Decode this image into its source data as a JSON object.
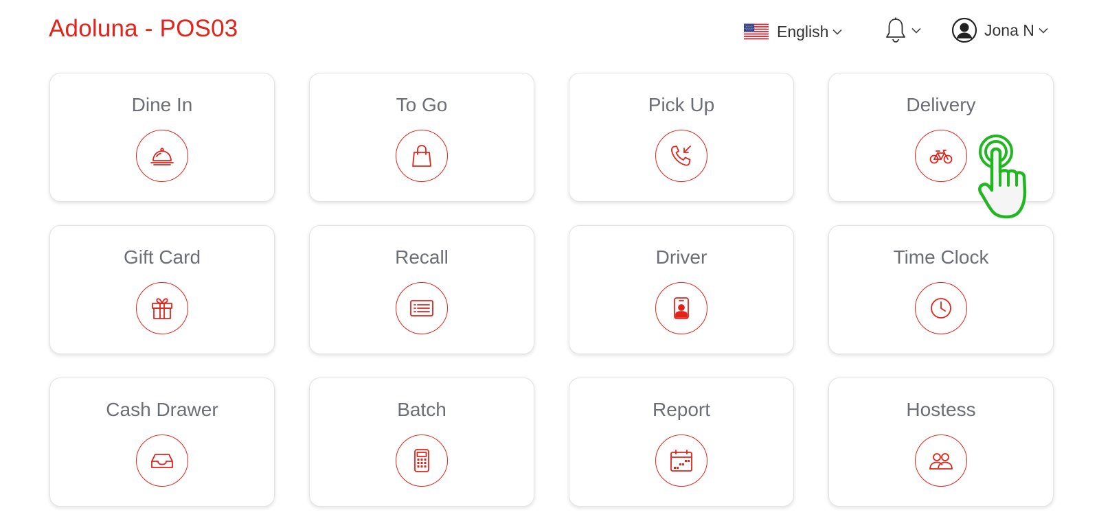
{
  "header": {
    "title": "Adoluna - POS03",
    "language": {
      "label": "English",
      "flag_icon": "us-flag-icon"
    },
    "notifications": {
      "icon": "bell-icon"
    },
    "user": {
      "name": "Jona N",
      "icon": "user-avatar-icon"
    }
  },
  "tiles": [
    {
      "label": "Dine In",
      "icon": "serving-cloche-icon"
    },
    {
      "label": "To Go",
      "icon": "shopping-bag-icon"
    },
    {
      "label": "Pick Up",
      "icon": "incoming-call-icon"
    },
    {
      "label": "Delivery",
      "icon": "bicycle-icon"
    },
    {
      "label": "Gift Card",
      "icon": "gift-icon"
    },
    {
      "label": "Recall",
      "icon": "list-card-icon"
    },
    {
      "label": "Driver",
      "icon": "id-badge-icon"
    },
    {
      "label": "Time Clock",
      "icon": "clock-icon"
    },
    {
      "label": "Cash Drawer",
      "icon": "inbox-tray-icon"
    },
    {
      "label": "Batch",
      "icon": "calculator-icon"
    },
    {
      "label": "Report",
      "icon": "calendar-icon"
    },
    {
      "label": "Hostess",
      "icon": "people-icon"
    }
  ],
  "colors": {
    "brand": "#e2231a",
    "tile_label": "#6b6e74",
    "tap_hint": "#22b722"
  }
}
